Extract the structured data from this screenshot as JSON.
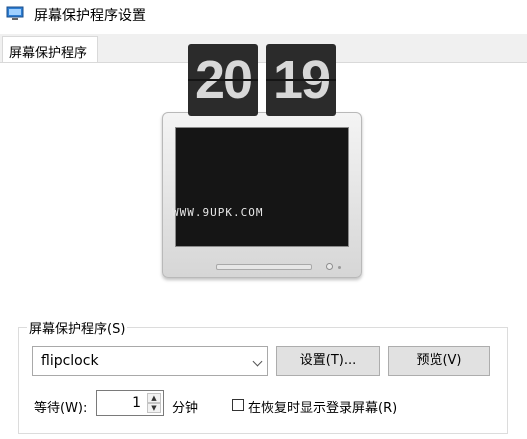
{
  "window": {
    "title": "屏幕保护程序设置"
  },
  "tabs": [
    {
      "label": "屏幕保护程序"
    }
  ],
  "preview": {
    "digits_left": "20",
    "digits_right": "19",
    "watermark": "WWW.9UPK.COM"
  },
  "screensaver_group": {
    "legend": "屏幕保护程序(S)",
    "selected": "flipclock",
    "settings_label": "设置(T)...",
    "preview_label": "预览(V)"
  },
  "wait": {
    "label": "等待(W):",
    "value": "1",
    "unit": "分钟"
  },
  "resume": {
    "checked": false,
    "label": "在恢复时显示登录屏幕(R)"
  }
}
